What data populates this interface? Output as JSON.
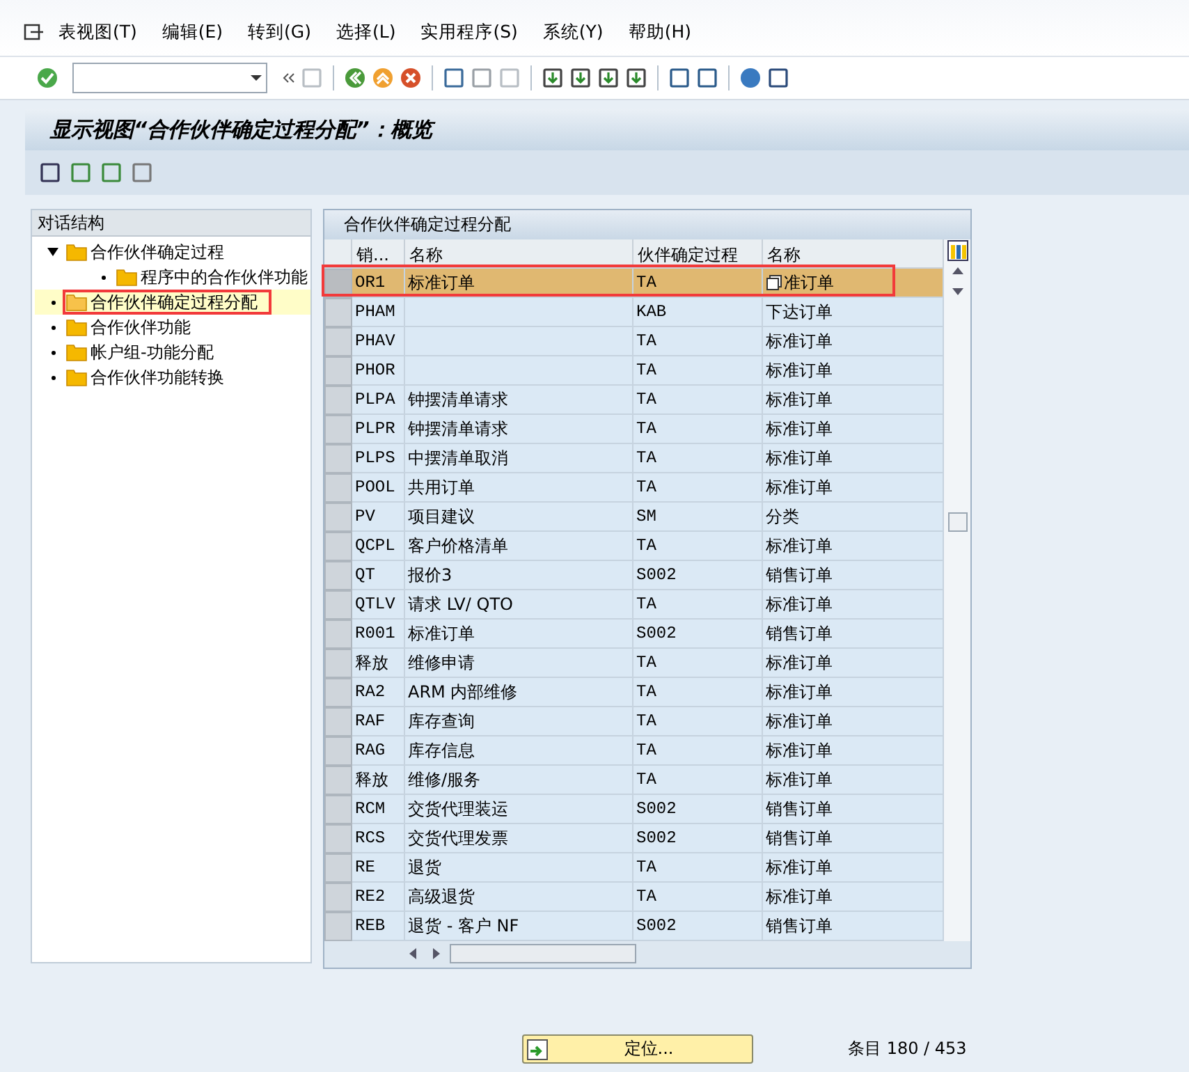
{
  "menu": [
    "表视图(T)",
    "编辑(E)",
    "转到(G)",
    "选择(L)",
    "实用程序(S)",
    "系统(Y)",
    "帮助(H)"
  ],
  "title": "显示视图“合作伙伴确定过程分配”：概览",
  "tree": {
    "title": "对话结构",
    "nodes": [
      {
        "label": "合作伙伴确定过程",
        "expanded": true,
        "selected": false,
        "children": [
          {
            "label": "程序中的合作伙伴功能",
            "selected": false
          }
        ]
      },
      {
        "label": "合作伙伴确定过程分配",
        "selected": true,
        "highlighted": true
      },
      {
        "label": "合作伙伴功能",
        "selected": false
      },
      {
        "label": "帐户组-功能分配",
        "selected": false
      },
      {
        "label": "合作伙伴功能转换",
        "selected": false
      }
    ]
  },
  "table": {
    "title": "合作伙伴确定过程分配",
    "columns": [
      "销...",
      "名称",
      "伙伴确定过程",
      "名称"
    ],
    "rows": [
      {
        "cells": [
          "OR1",
          "标准订单",
          "TA",
          "准订单"
        ],
        "selected": true
      },
      {
        "cells": [
          "PHAM",
          "",
          "KAB",
          "下达订单"
        ],
        "selected": false
      },
      {
        "cells": [
          "PHAV",
          "",
          "TA",
          "标准订单"
        ],
        "selected": false
      },
      {
        "cells": [
          "PHOR",
          "",
          "TA",
          "标准订单"
        ],
        "selected": false
      },
      {
        "cells": [
          "PLPA",
          "钟摆清单请求",
          "TA",
          "标准订单"
        ],
        "selected": false
      },
      {
        "cells": [
          "PLPR",
          "钟摆清单请求",
          "TA",
          "标准订单"
        ],
        "selected": false
      },
      {
        "cells": [
          "PLPS",
          "中摆清单取消",
          "TA",
          "标准订单"
        ],
        "selected": false
      },
      {
        "cells": [
          "POOL",
          "共用订单",
          "TA",
          "标准订单"
        ],
        "selected": false
      },
      {
        "cells": [
          "PV",
          "项目建议",
          "SM",
          "分类"
        ],
        "selected": false
      },
      {
        "cells": [
          "QCPL",
          "客户价格清单",
          "TA",
          "标准订单"
        ],
        "selected": false
      },
      {
        "cells": [
          "QT",
          "报价3",
          "S002",
          "销售订单"
        ],
        "selected": false
      },
      {
        "cells": [
          "QTLV",
          "请求 LV/ QTO",
          "TA",
          "标准订单"
        ],
        "selected": false
      },
      {
        "cells": [
          "R001",
          "标准订单",
          "S002",
          "销售订单"
        ],
        "selected": false
      },
      {
        "cells": [
          "释放",
          "维修申请",
          "TA",
          "标准订单"
        ],
        "selected": false
      },
      {
        "cells": [
          "RA2",
          "ARM 内部维修",
          "TA",
          "标准订单"
        ],
        "selected": false
      },
      {
        "cells": [
          "RAF",
          "库存查询",
          "TA",
          "标准订单"
        ],
        "selected": false
      },
      {
        "cells": [
          "RAG",
          "库存信息",
          "TA",
          "标准订单"
        ],
        "selected": false
      },
      {
        "cells": [
          "释放",
          "维修/服务",
          "TA",
          "标准订单"
        ],
        "selected": false
      },
      {
        "cells": [
          "RCM",
          "交货代理装运",
          "S002",
          "销售订单"
        ],
        "selected": false
      },
      {
        "cells": [
          "RCS",
          "交货代理发票",
          "S002",
          "销售订单"
        ],
        "selected": false
      },
      {
        "cells": [
          "RE",
          "退货",
          "TA",
          "标准订单"
        ],
        "selected": false
      },
      {
        "cells": [
          "RE2",
          "高级退货",
          "TA",
          "标准订单"
        ],
        "selected": false
      },
      {
        "cells": [
          "REB",
          "退货 - 客户 NF",
          "S002",
          "销售订单"
        ],
        "selected": false
      }
    ]
  },
  "position_button": "定位...",
  "entries": "条目 180 / 453"
}
